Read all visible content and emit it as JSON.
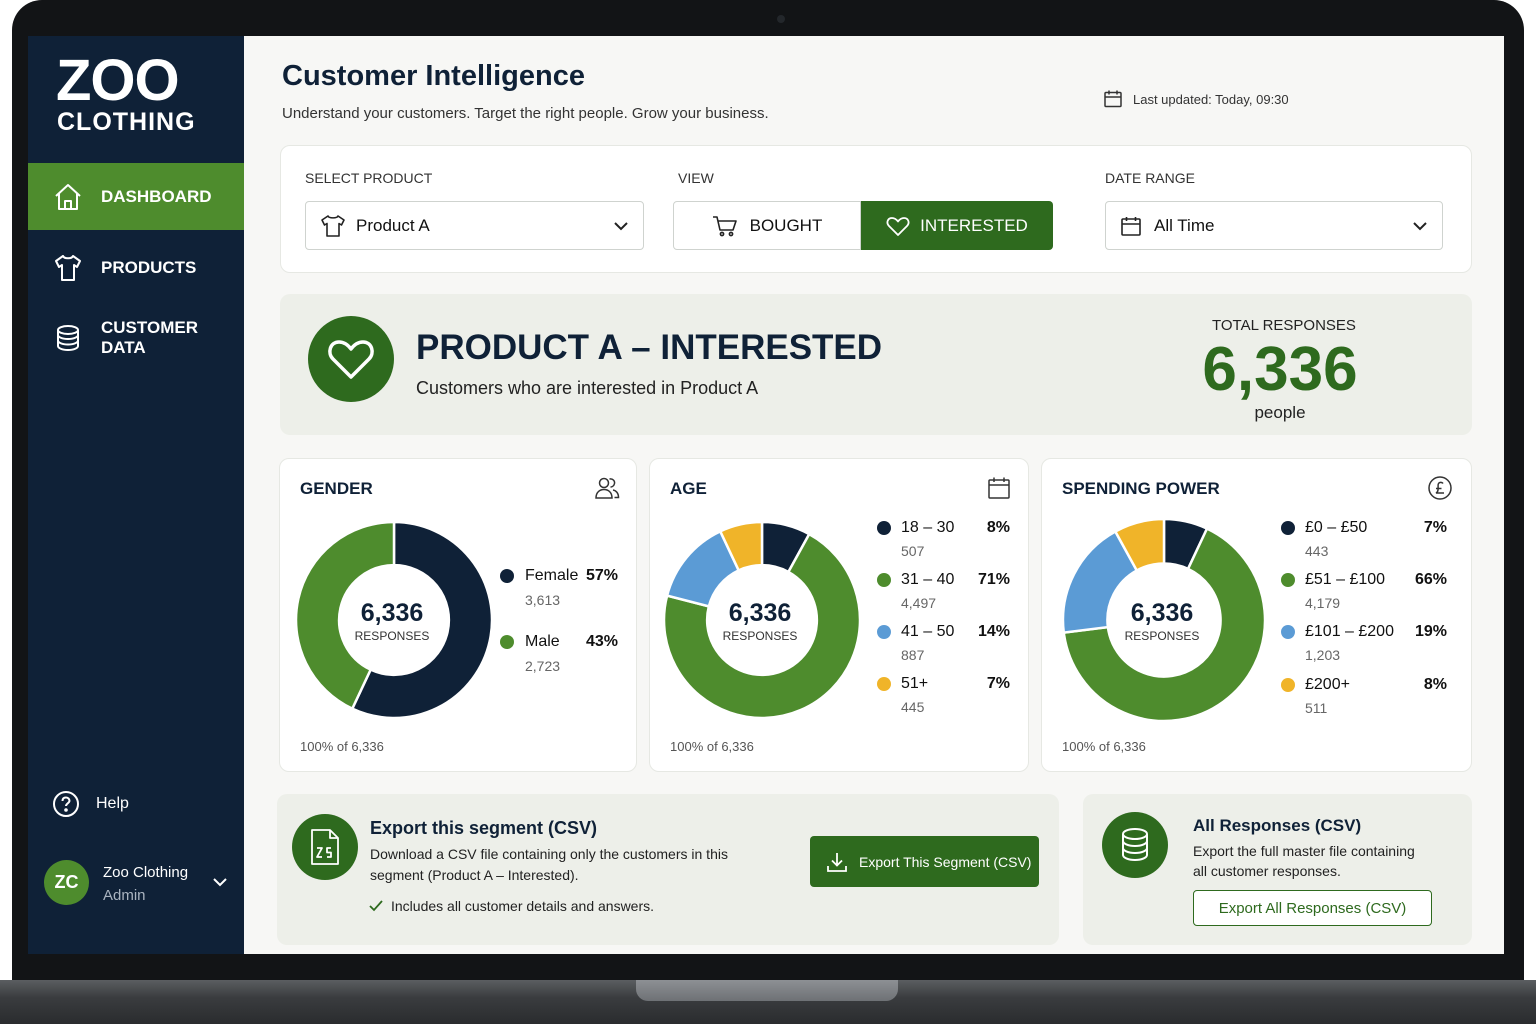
{
  "brand": {
    "name": "ZOO",
    "sub": "CLOTHING"
  },
  "colors": {
    "navy": "#0f2137",
    "green": "#4e8c2d",
    "dark_green": "#2e6a1e",
    "blue": "#5b9bd5",
    "yellow": "#f0b429"
  },
  "sidebar": {
    "items": [
      {
        "label": "DASHBOARD",
        "icon": "home-icon",
        "active": true
      },
      {
        "label": "PRODUCTS",
        "icon": "shirt-icon",
        "active": false
      },
      {
        "label": "CUSTOMER DATA",
        "icon": "database-icon",
        "active": false
      }
    ],
    "help": "Help",
    "user": {
      "initials": "ZC",
      "name": "Zoo Clothing",
      "role": "Admin"
    }
  },
  "header": {
    "title": "Customer Intelligence",
    "subtitle": "Understand your customers. Target the right people. Grow your business.",
    "updated": "Last updated: Today, 09:30"
  },
  "filters": {
    "product_label": "SELECT PRODUCT",
    "product_value": "Product A",
    "view_label": "VIEW",
    "view_bought": "BOUGHT",
    "view_interested": "INTERESTED",
    "view_selected": "INTERESTED",
    "date_label": "DATE RANGE",
    "date_value": "All Time"
  },
  "summary": {
    "title": "PRODUCT A – INTERESTED",
    "subtitle": "Customers who are interested in Product A",
    "total_label": "TOTAL RESPONSES",
    "total_value": "6,336",
    "total_unit": "people"
  },
  "chart_data": [
    {
      "type": "pie",
      "title": "GENDER",
      "center_value": "6,336",
      "center_label": "RESPONSES",
      "footnote": "100% of 6,336",
      "slices": [
        {
          "label": "Female",
          "percent": 57,
          "pct_text": "57%",
          "count": "3,613",
          "color": "#0f2137"
        },
        {
          "label": "Male",
          "percent": 43,
          "pct_text": "43%",
          "count": "2,723",
          "color": "#4e8c2d"
        }
      ]
    },
    {
      "type": "pie",
      "title": "AGE",
      "center_value": "6,336",
      "center_label": "RESPONSES",
      "footnote": "100% of 6,336",
      "slices": [
        {
          "label": "18 – 30",
          "percent": 8,
          "pct_text": "8%",
          "count": "507",
          "color": "#0f2137"
        },
        {
          "label": "31 – 40",
          "percent": 71,
          "pct_text": "71%",
          "count": "4,497",
          "color": "#4e8c2d"
        },
        {
          "label": "41 – 50",
          "percent": 14,
          "pct_text": "14%",
          "count": "887",
          "color": "#5b9bd5"
        },
        {
          "label": "51+",
          "percent": 7,
          "pct_text": "7%",
          "count": "445",
          "color": "#f0b429"
        }
      ]
    },
    {
      "type": "pie",
      "title": "SPENDING POWER",
      "center_value": "6,336",
      "center_label": "RESPONSES",
      "footnote": "100% of 6,336",
      "slices": [
        {
          "label": "£0 – £50",
          "percent": 7,
          "pct_text": "7%",
          "count": "443",
          "color": "#0f2137"
        },
        {
          "label": "£51 – £100",
          "percent": 66,
          "pct_text": "66%",
          "count": "4,179",
          "color": "#4e8c2d"
        },
        {
          "label": "£101 – £200",
          "percent": 19,
          "pct_text": "19%",
          "count": "1,203",
          "color": "#5b9bd5"
        },
        {
          "label": "£200+",
          "percent": 8,
          "pct_text": "8%",
          "count": "511",
          "color": "#f0b429"
        }
      ]
    }
  ],
  "export_segment": {
    "title": "Export this segment (CSV)",
    "text_1": "Download a CSV file containing only the customers in this",
    "text_2": "segment (Product A – Interested).",
    "check": "Includes all customer details and answers.",
    "button": "Export This Segment (CSV)"
  },
  "export_all": {
    "title": "All Responses (CSV)",
    "text_1": "Export the full master file containing",
    "text_2": "all customer responses.",
    "button": "Export All Responses (CSV)"
  }
}
